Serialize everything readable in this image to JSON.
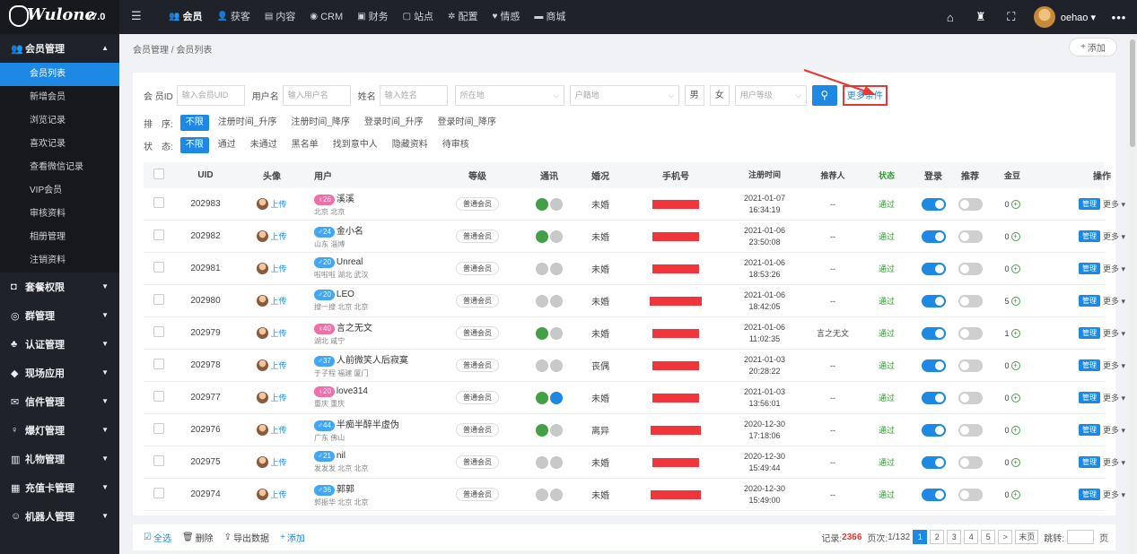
{
  "app": {
    "brand": "Wulone",
    "version": "v7.0"
  },
  "topnav": [
    {
      "icon": "users-icon",
      "glyph": "👥",
      "label": "会员",
      "active": true
    },
    {
      "icon": "person-icon",
      "glyph": "👤",
      "label": "获客"
    },
    {
      "icon": "document-icon",
      "glyph": "▤",
      "label": "内容"
    },
    {
      "icon": "globe-icon",
      "glyph": "◉",
      "label": "CRM"
    },
    {
      "icon": "finance-icon",
      "glyph": "▣",
      "label": "财务"
    },
    {
      "icon": "site-icon",
      "glyph": "▢",
      "label": "站点"
    },
    {
      "icon": "gear-icon",
      "glyph": "✲",
      "label": "配置"
    },
    {
      "icon": "heart-icon",
      "glyph": "♥",
      "label": "情感"
    },
    {
      "icon": "shop-icon",
      "glyph": "▬",
      "label": "商城"
    }
  ],
  "user": {
    "name": "oehao"
  },
  "sidebar": {
    "groups": [
      {
        "icon": "users-icon",
        "glyph": "👥",
        "label": "会员管理",
        "expanded": true,
        "items": [
          "会员列表",
          "新增会员",
          "浏览记录",
          "喜欢记录",
          "查看微信记录",
          "VIP会员",
          "审核资料",
          "相册管理",
          "注销资料"
        ]
      },
      {
        "icon": "package-icon",
        "glyph": "◘",
        "label": "套餐权限"
      },
      {
        "icon": "group-icon",
        "glyph": "◎",
        "label": "群管理"
      },
      {
        "icon": "verify-icon",
        "glyph": "♣",
        "label": "认证管理"
      },
      {
        "icon": "onsite-icon",
        "glyph": "◆",
        "label": "现场应用"
      },
      {
        "icon": "mail-icon",
        "glyph": "✉",
        "label": "信件管理"
      },
      {
        "icon": "lamp-icon",
        "glyph": "♀",
        "label": "爆灯管理"
      },
      {
        "icon": "gift-icon",
        "glyph": "▥",
        "label": "礼物管理"
      },
      {
        "icon": "card-icon",
        "glyph": "▦",
        "label": "充值卡管理"
      },
      {
        "icon": "robot-icon",
        "glyph": "☺",
        "label": "机器人管理"
      }
    ]
  },
  "breadcrumb": "会员管理 / 会员列表",
  "add_label": "添加",
  "filters": {
    "member_label": "会 员ID",
    "member_placeholder": "输入会员UID",
    "username_label": "用户名",
    "username_placeholder": "输入用户名",
    "name_label": "姓名",
    "name_placeholder": "输入姓名",
    "location_placeholder": "所在地",
    "hometown_placeholder": "户籍地",
    "male": "男",
    "female": "女",
    "level_placeholder": "用户等级",
    "more_conditions": "更多条件"
  },
  "sort": {
    "label": "排　序:",
    "options": [
      "不限",
      "注册时间_升序",
      "注册时间_降序",
      "登录时间_升序",
      "登录时间_降序"
    ]
  },
  "status_filter": {
    "label": "状　态:",
    "options": [
      "不限",
      "通过",
      "未通过",
      "黑名单",
      "找到意中人",
      "隐藏资料",
      "待审核"
    ]
  },
  "table": {
    "headers": [
      "UID",
      "头像",
      "用户",
      "等级",
      "通讯",
      "婚况",
      "手机号",
      "注册时间",
      "推荐人",
      "状态",
      "登录",
      "推荐",
      "金豆",
      "操作"
    ],
    "upload_label": "上传",
    "manage_label": "管理",
    "more_label": "更多",
    "rows": [
      {
        "uid": "202983",
        "gender": "f",
        "age": "26",
        "name": "溪溪",
        "loc": "北京 北京",
        "level": "普通会员",
        "wx": true,
        "qq": false,
        "marital": "未婚",
        "phone_w": 52,
        "date": "2021-01-07",
        "time": "16:34:19",
        "ref": "--",
        "status": "通过",
        "gold": "0"
      },
      {
        "uid": "202982",
        "gender": "m",
        "age": "24",
        "name": "金小名",
        "loc": "山东 淄博",
        "level": "普通会员",
        "wx": true,
        "qq": false,
        "marital": "未婚",
        "phone_w": 52,
        "date": "2021-01-06",
        "time": "23:50:08",
        "ref": "--",
        "status": "通过",
        "gold": "0"
      },
      {
        "uid": "202981",
        "gender": "m",
        "age": "20",
        "name": "Unreal",
        "loc": "啦啦啦 湖北 武汉",
        "level": "普通会员",
        "wx": false,
        "qq": false,
        "marital": "未婚",
        "phone_w": 52,
        "date": "2021-01-06",
        "time": "18:53:26",
        "ref": "--",
        "status": "通过",
        "gold": "0"
      },
      {
        "uid": "202980",
        "gender": "m",
        "age": "20",
        "name": "LEO",
        "loc": "搜一搜 北京 北京",
        "level": "普通会员",
        "wx": false,
        "qq": false,
        "marital": "未婚",
        "phone_w": 58,
        "date": "2021-01-06",
        "time": "18:42:05",
        "ref": "--",
        "status": "通过",
        "gold": "5"
      },
      {
        "uid": "202979",
        "gender": "f",
        "age": "40",
        "name": "言之无文",
        "loc": "湖北 咸宁",
        "level": "普通会员",
        "wx": true,
        "qq": false,
        "marital": "未婚",
        "phone_w": 52,
        "date": "2021-01-06",
        "time": "11:02:35",
        "ref": "言之无文",
        "status": "通过",
        "gold": "1"
      },
      {
        "uid": "202978",
        "gender": "m",
        "age": "37",
        "name": "人前微笑人后寂寞",
        "loc": "于子程 福建 厦门",
        "level": "普通会员",
        "wx": false,
        "qq": false,
        "marital": "丧偶",
        "phone_w": 52,
        "date": "2021-01-03",
        "time": "20:28:22",
        "ref": "--",
        "status": "通过",
        "gold": "0"
      },
      {
        "uid": "202977",
        "gender": "f",
        "age": "20",
        "name": "love314",
        "loc": "重庆 重庆",
        "level": "普通会员",
        "wx": true,
        "qq": true,
        "marital": "未婚",
        "phone_w": 52,
        "date": "2021-01-03",
        "time": "13:56:01",
        "ref": "--",
        "status": "通过",
        "gold": "0"
      },
      {
        "uid": "202976",
        "gender": "m",
        "age": "44",
        "name": "半痴半醉半虚伪",
        "loc": "广东 佛山",
        "level": "普通会员",
        "wx": true,
        "qq": false,
        "marital": "离异",
        "phone_w": 56,
        "date": "2020-12-30",
        "time": "17:18:06",
        "ref": "--",
        "status": "通过",
        "gold": "0"
      },
      {
        "uid": "202975",
        "gender": "m",
        "age": "21",
        "name": "nil",
        "loc": "发发发 北京 北京",
        "level": "普通会员",
        "wx": false,
        "qq": false,
        "marital": "未婚",
        "phone_w": 52,
        "date": "2020-12-30",
        "time": "15:49:44",
        "ref": "--",
        "status": "通过",
        "gold": "0"
      },
      {
        "uid": "202974",
        "gender": "m",
        "age": "36",
        "name": "郭郭",
        "loc": "郭振华 北京 北京",
        "level": "普通会员",
        "wx": false,
        "qq": false,
        "marital": "未婚",
        "phone_w": 56,
        "date": "2020-12-30",
        "time": "15:49:00",
        "ref": "--",
        "status": "通过",
        "gold": "0"
      }
    ]
  },
  "bottom": {
    "select_all": "全选",
    "delete": "删除",
    "export": "导出数据",
    "add": "添加",
    "records_label": "记录:",
    "records": "2366",
    "page_label": "页次:",
    "page_info": "1/132",
    "pages": [
      "1",
      "2",
      "3",
      "4",
      "5"
    ],
    "next": ">",
    "last": "末页",
    "jump": "跳转:",
    "page_unit": "页"
  }
}
